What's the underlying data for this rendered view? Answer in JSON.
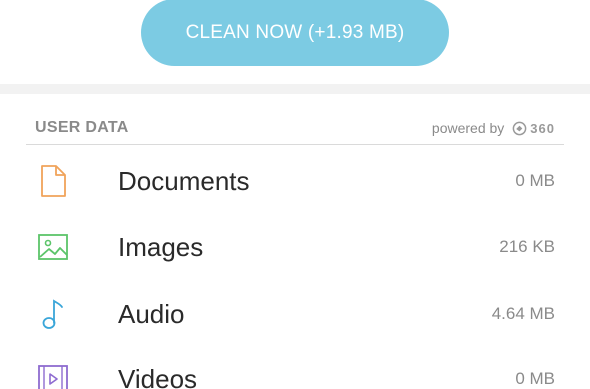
{
  "clean_button": {
    "label": "CLEAN NOW (+1.93 MB)"
  },
  "section": {
    "title": "USER DATA",
    "powered_by": "powered by",
    "powered_logo_text": "360"
  },
  "items": [
    {
      "label": "Documents",
      "size": "0 MB",
      "icon": "document-icon",
      "color": "#f0a35a"
    },
    {
      "label": "Images",
      "size": "216 KB",
      "icon": "image-icon",
      "color": "#5cc46a"
    },
    {
      "label": "Audio",
      "size": "4.64 MB",
      "icon": "music-note-icon",
      "color": "#3aa6d9"
    },
    {
      "label": "Videos",
      "size": "0 MB",
      "icon": "video-icon",
      "color": "#8e6bd0"
    }
  ],
  "colors": {
    "accent": "#7ccbe3",
    "background": "#f2f2f2"
  }
}
